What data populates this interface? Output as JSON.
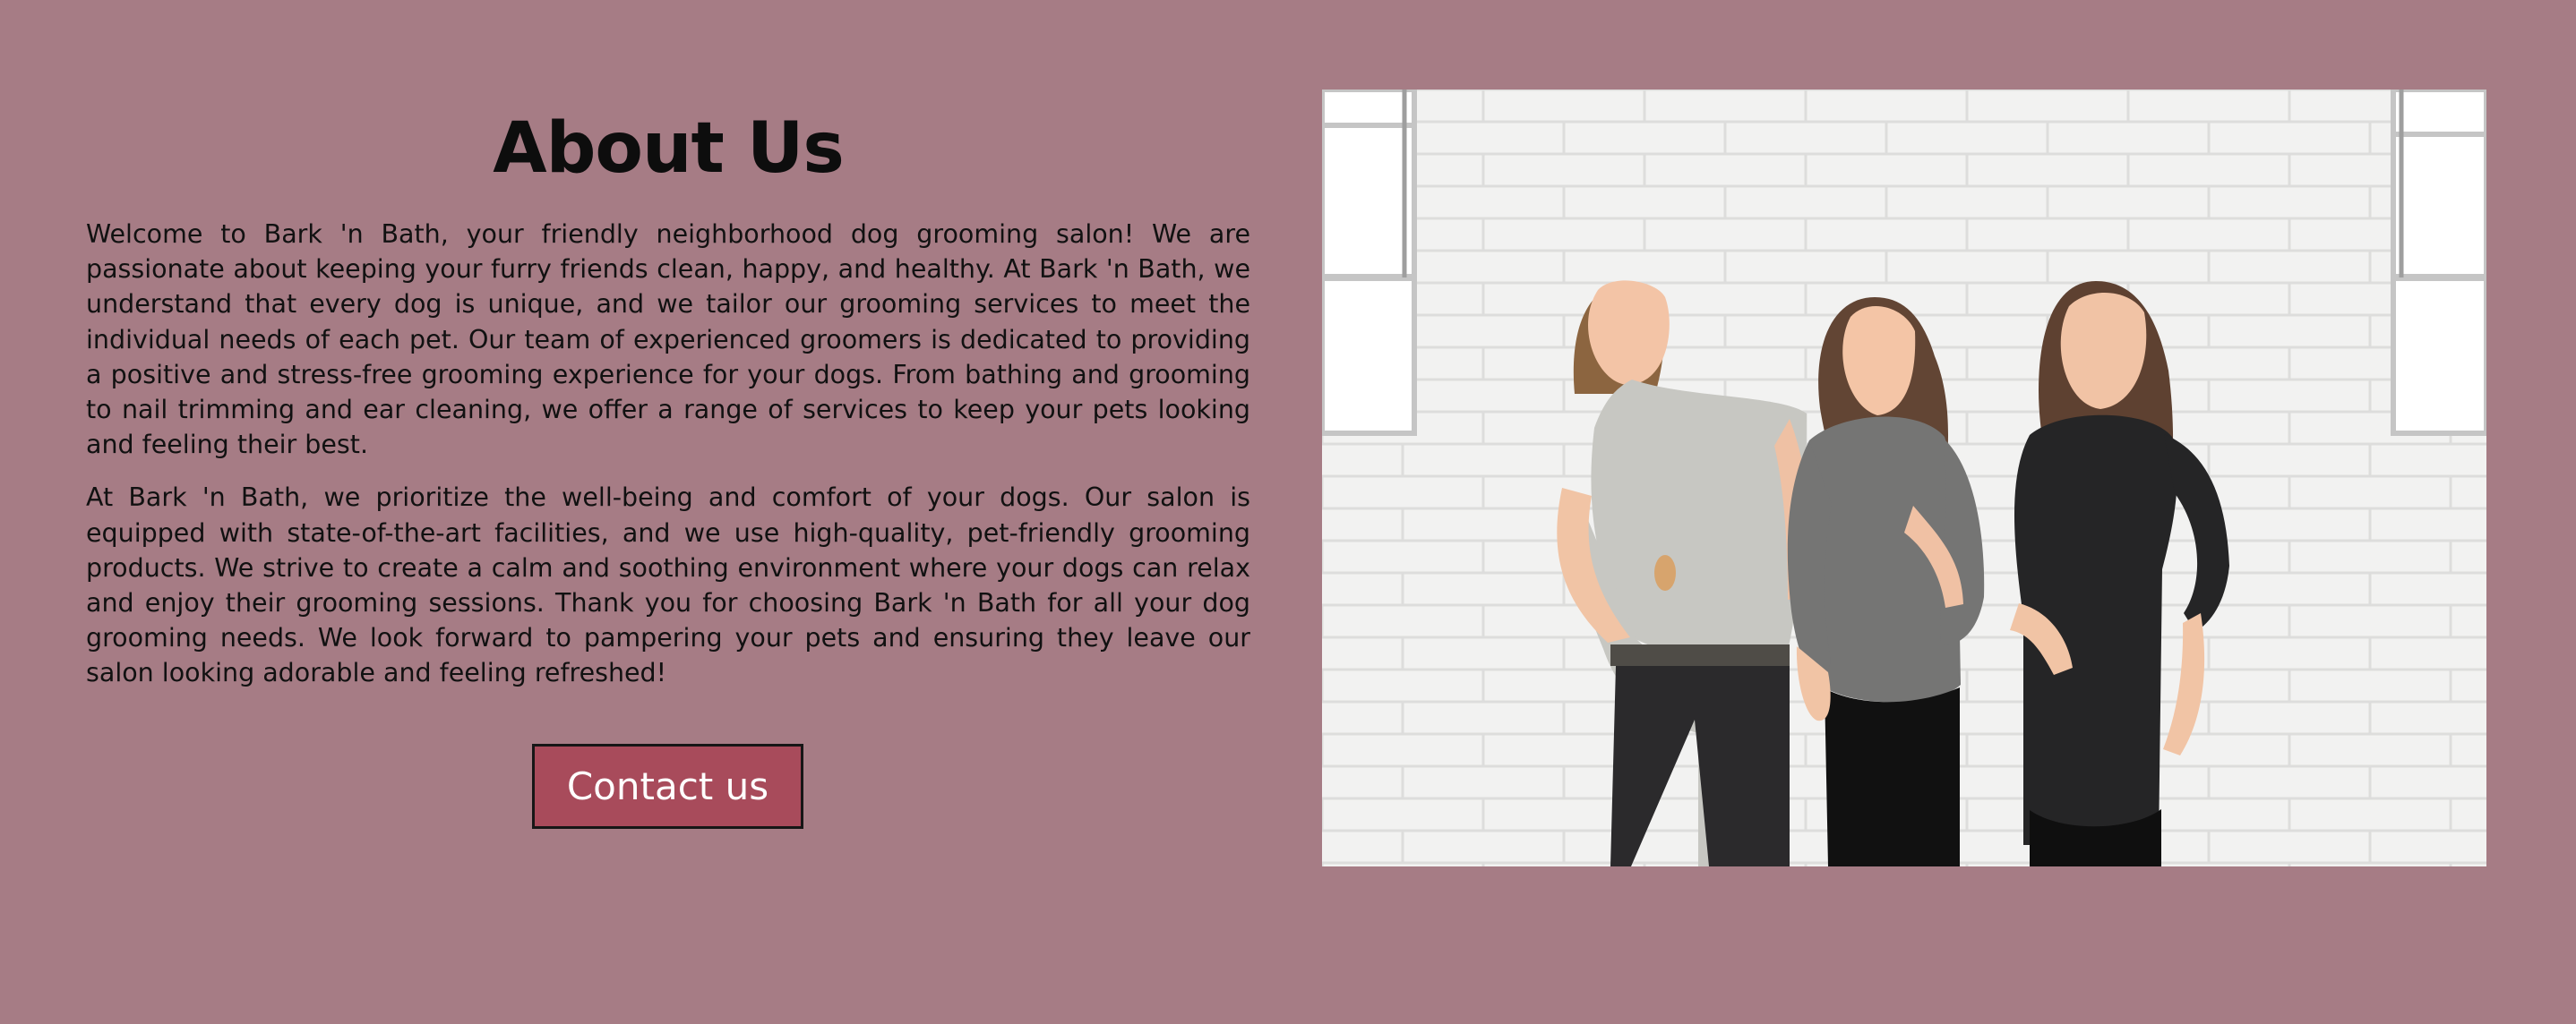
{
  "about": {
    "title": "About Us",
    "paragraphs": [
      "Welcome to Bark 'n Bath, your friendly neighborhood dog grooming salon! We are passionate about keeping your furry friends clean, happy, and healthy. At Bark 'n Bath, we understand that every dog is unique, and we tailor our grooming services to meet the individual needs of each pet. Our team of experienced groomers is dedicated to providing a positive and stress-free grooming experience for your dogs. From bathing and grooming to nail trimming and ear cleaning, we offer a range of services to keep your pets looking and feeling their best.",
      "At Bark 'n Bath, we prioritize the well-being and comfort of your dogs. Our salon is equipped with state-of-the-art facilities, and we use high-quality, pet-friendly grooming products. We strive to create a calm and soothing environment where your dogs can relax and enjoy their grooming sessions. Thank you for choosing Bark 'n Bath for all your dog grooming needs. We look forward to pampering your pets and ensuring they leave our salon looking adorable and feeling refreshed!"
    ],
    "contact_button_label": "Contact us"
  },
  "colors": {
    "page_background": "#a67c85",
    "button_background": "#a84b5b",
    "button_border": "#161616",
    "text": "#111111",
    "photo_wall": "#f1f1f0"
  }
}
